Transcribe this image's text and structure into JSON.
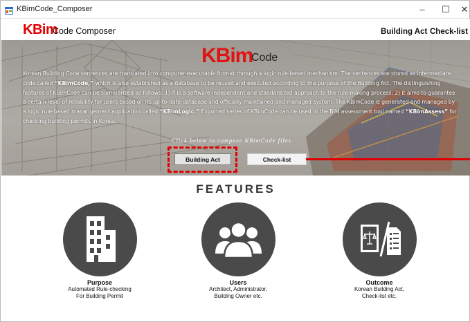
{
  "window": {
    "title": "KBimCode_Composer",
    "controls": {
      "minimize": "–",
      "maximize": "☐",
      "close": "✕"
    }
  },
  "header": {
    "logo_mark": "KBim",
    "logo_text": "Code Composer",
    "nav": [
      "Building Act",
      "Check-list"
    ]
  },
  "hero": {
    "logo_mark": "KBim",
    "logo_text": "Code",
    "paragraph": [
      {
        "t": "Korean Building Code sentences are translated into computer-executable format through a logic rule-based mechanism. The sentences are stored as intermediate code called "
      },
      {
        "t": "“KBimCode,”",
        "b": true
      },
      {
        "t": " which is also established as a database to be reused and executed according to the purpose of the Building Act. The distinguishing features of KBimCode can be summarized as follows: 1) it is a software-independent and standardized approach to the rule-making process; 2) it aims to guarantee a certain level of reliability for users based on its up-to-date database and officially maintained and managed system. The KBimCode is generated and managed by a logic rule-based manangement application called "
      },
      {
        "t": "“KBimLogic.”",
        "b": true
      },
      {
        "t": " Exported series of KBimCode can be used in the BIM assessment tool named "
      },
      {
        "t": "“KBimAssess”",
        "b": true
      },
      {
        "t": " for checking building permits in Korea."
      }
    ],
    "cta": "Click below to compose KBimCode files",
    "buttons": {
      "building_act": "Building Act",
      "check_list": "Check-list"
    }
  },
  "features": {
    "title": "FEATURES",
    "items": [
      {
        "icon": "building-icon",
        "title": "Purpose",
        "desc": [
          "Automated Rule-checking",
          "For Building Permit"
        ]
      },
      {
        "icon": "users-icon",
        "title": "Users",
        "desc": [
          "Architect, Administrator,",
          "Building Owner etc."
        ]
      },
      {
        "icon": "documents-icon",
        "title": "Outcome",
        "desc": [
          "Korean Building Act,",
          "Check-list etc."
        ]
      }
    ]
  },
  "colors": {
    "brand_red": "#e00000",
    "circle_gray": "#4a4a4a",
    "annotation_red": "#e00000"
  }
}
